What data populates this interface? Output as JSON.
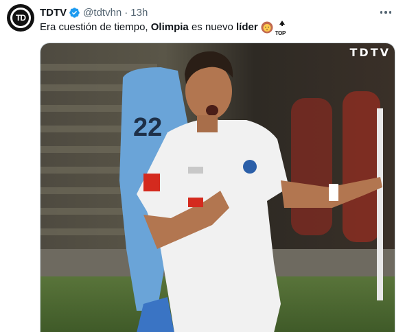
{
  "author": {
    "display_name": "TDTV",
    "handle": "@tdtvhn",
    "separator": "·",
    "time": "13h",
    "avatar_text": "TD",
    "verified": true
  },
  "tweet": {
    "text_part1": "Era cuestión de tiempo, ",
    "bold1": "Olimpia",
    "text_part2": " es nuevo ",
    "bold2": "líder",
    "emoji_top_label": "TOP"
  },
  "media": {
    "watermark": "TDTV",
    "jersey_number": "22"
  },
  "icons": {
    "verified": "verified-badge-icon",
    "more": "more-options-icon",
    "lion": "lion-emoji-icon",
    "top": "top-arrow-emoji-icon"
  },
  "colors": {
    "verified_blue": "#1d9bf0",
    "text_primary": "#0f1419",
    "text_secondary": "#536471"
  }
}
